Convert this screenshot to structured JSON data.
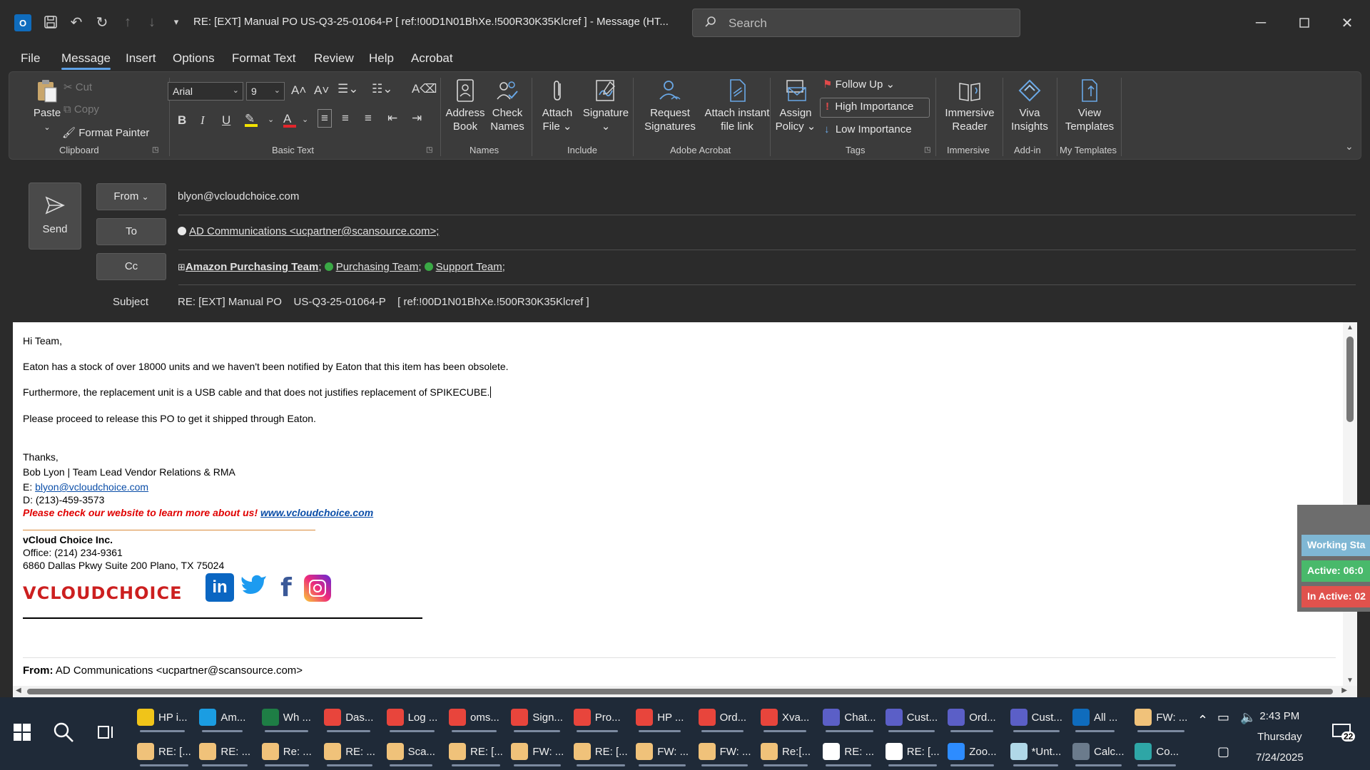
{
  "window": {
    "title": "RE: [EXT] Manual PO    US-Q3-25-01064-P    [ ref:!00D1N01BhXe.!500R30K35Klcref ]  -  Message (HT...",
    "search_placeholder": "Search"
  },
  "menu": [
    "File",
    "Message",
    "Insert",
    "Options",
    "Format Text",
    "Review",
    "Help",
    "Acrobat"
  ],
  "ribbon": {
    "clipboard": {
      "paste": "Paste",
      "cut": "Cut",
      "copy": "Copy",
      "format_painter": "Format Painter",
      "label": "Clipboard"
    },
    "basic_text": {
      "font": "Arial",
      "size": "9",
      "label": "Basic Text"
    },
    "names": {
      "address_book_1": "Address",
      "address_book_2": "Book",
      "check_names_1": "Check",
      "check_names_2": "Names",
      "label": "Names"
    },
    "include": {
      "attach_1": "Attach",
      "attach_2": "File",
      "signature": "Signature",
      "label": "Include"
    },
    "adobe": {
      "request_1": "Request",
      "request_2": "Signatures",
      "attach_link_1": "Attach instant",
      "attach_link_2": "file link",
      "label": "Adobe Acrobat"
    },
    "tags": {
      "assign_1": "Assign",
      "assign_2": "Policy",
      "follow_up": "Follow Up",
      "high": "High Importance",
      "low": "Low Importance",
      "label": "Tags"
    },
    "immersive": {
      "reader_1": "Immersive",
      "reader_2": "Reader",
      "label": "Immersive"
    },
    "addin": {
      "viva_1": "Viva",
      "viva_2": "Insights",
      "label": "Add-in"
    },
    "templates": {
      "view_1": "View",
      "view_2": "Templates",
      "label": "My Templates"
    }
  },
  "compose": {
    "send": "Send",
    "from_label": "From",
    "from_value": "blyon@vcloudchoice.com",
    "to_label": "To",
    "to_value": "AD Communications <ucpartner@scansource.com>;",
    "cc_label": "Cc",
    "cc_1": "Amazon Purchasing Team",
    "cc_2": "Purchasing Team",
    "cc_3": "Support Team",
    "subject_label": "Subject",
    "subject_value": "RE: [EXT] Manual PO    US-Q3-25-01064-P    [ ref:!00D1N01BhXe.!500R30K35Klcref ]"
  },
  "body": {
    "greeting": "Hi Team,",
    "p1": "Eaton has a stock of over 18000 units and we haven't been notified by Eaton that this item has been obsolete.",
    "p2": "Furthermore, the replacement unit is a USB cable and that does not justifies replacement of SPIKECUBE.",
    "p3": "Please proceed to release this PO to get it shipped through Eaton.",
    "thanks": "Thanks,",
    "name_line": "Bob Lyon | Team Lead Vendor Relations & RMA",
    "email_prefix": "E: ",
    "email": "blyon@vcloudchoice.com",
    "phone": "D: (213)-459-3573",
    "website_prompt": "Please check our website to learn more about us!",
    "website": "www.vcloudchoice.com",
    "company": "vCloud Choice Inc.",
    "office": "Office: (214) 234-9361",
    "address": "6860 Dallas Pkwy Suite 200 Plano, TX 75024",
    "logo_text": "VCLOUDCHOICE",
    "from_label": "From:",
    "from_value": "AD Communications <ucpartner@scansource.com>"
  },
  "status_overlay": {
    "working": "Working Sta",
    "active": "Active: 06:0",
    "inactive": "In Active: 02"
  },
  "taskbar": {
    "row1": [
      "HP i...",
      "Am...",
      "Wh ...",
      "Das...",
      "Log ...",
      "oms...",
      "Sign...",
      "Pro...",
      "HP ...",
      "Ord...",
      "Xva...",
      "Chat...",
      "Cust...",
      "Ord...",
      "Cust...",
      "All ...",
      "FW: ..."
    ],
    "row2": [
      "RE: [...",
      "RE: ...",
      "Re: ...",
      "RE: ...",
      "Sca...",
      "RE: [...",
      "FW: ...",
      "RE: [...",
      "FW: ...",
      "FW: ...",
      "Re:[...",
      "RE: ...",
      "RE: [...",
      "Zoo...",
      "*Unt...",
      "Calc...",
      "Co..."
    ],
    "time": "2:43 PM",
    "day": "Thursday",
    "date": "7/24/2025",
    "notifications": "22"
  }
}
